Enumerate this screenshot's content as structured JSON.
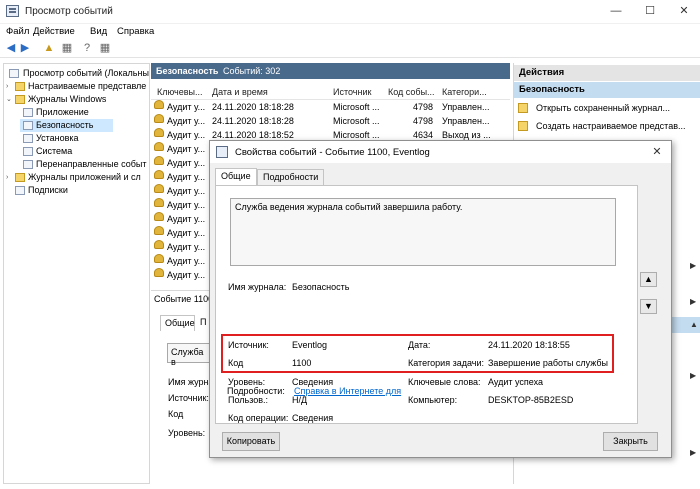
{
  "app": {
    "title": "Просмотр событий",
    "min": "—",
    "max": "☐",
    "close": "✕"
  },
  "menu": [
    "Файл",
    "Действие",
    "Вид",
    "Справка"
  ],
  "tree": {
    "root": "Просмотр событий (Локальны",
    "custom": "Настраиваемые представле",
    "winlogs": "Журналы Windows",
    "app": "Приложение",
    "security": "Безопасность",
    "setup": "Установка",
    "system": "Система",
    "forwarded": "Перенаправленные событ",
    "applogs": "Журналы приложений и сл",
    "subs": "Подписки"
  },
  "center": {
    "header_name": "Безопасность",
    "header_count": "Событий: 302",
    "columns": [
      "Ключевы...",
      "Дата и время",
      "Источник",
      "Код собы...",
      "Категори..."
    ],
    "rows": [
      {
        "kw": "Аудит у...",
        "date": "24.11.2020 18:18:28",
        "src": "Microsoft ...",
        "code": "4798",
        "cat": "Управлен..."
      },
      {
        "kw": "Аудит у...",
        "date": "24.11.2020 18:18:28",
        "src": "Microsoft ...",
        "code": "4798",
        "cat": "Управлен..."
      },
      {
        "kw": "Аудит у...",
        "date": "24.11.2020 18:18:52",
        "src": "Microsoft ...",
        "code": "4634",
        "cat": "Выход из ..."
      },
      {
        "kw": "Аудит у...",
        "date": "",
        "src": "",
        "code": "",
        "cat": ""
      },
      {
        "kw": "Аудит у...",
        "date": "",
        "src": "",
        "code": "",
        "cat": ""
      },
      {
        "kw": "Аудит у...",
        "date": "",
        "src": "",
        "code": "",
        "cat": ""
      },
      {
        "kw": "Аудит у...",
        "date": "",
        "src": "",
        "code": "",
        "cat": ""
      },
      {
        "kw": "Аудит у...",
        "date": "",
        "src": "",
        "code": "",
        "cat": ""
      },
      {
        "kw": "Аудит у...",
        "date": "",
        "src": "",
        "code": "",
        "cat": ""
      },
      {
        "kw": "Аудит у...",
        "date": "",
        "src": "",
        "code": "",
        "cat": ""
      },
      {
        "kw": "Аудит у...",
        "date": "",
        "src": "",
        "code": "",
        "cat": ""
      },
      {
        "kw": "Аудит у...",
        "date": "",
        "src": "",
        "code": "",
        "cat": ""
      },
      {
        "kw": "Аудит у...",
        "date": "",
        "src": "",
        "code": "",
        "cat": ""
      }
    ],
    "lower_title": "Событие 1100",
    "lower_tab1": "Общие",
    "lower_tab2": "П",
    "lower_text": "Служба в",
    "lower_f1": "Имя журна",
    "lower_f2": "Источник:",
    "lower_f3": "Код",
    "lower_f4": "Уровень:"
  },
  "actions": {
    "header": "Действия",
    "section": "Безопасность",
    "open_saved": "Открыть сохраненный журнал...",
    "create_view": "Создать настраиваемое представ..."
  },
  "dialog": {
    "title": "Свойства событий - Событие 1100, Eventlog",
    "close": "✕",
    "tab_general": "Общие",
    "tab_details": "Подробности",
    "message": "Служба ведения журнала событий завершила работу.",
    "log_name_label": "Имя журнала:",
    "log_name": "Безопасность",
    "source_label": "Источник:",
    "source": "Eventlog",
    "date_label": "Дата:",
    "date": "24.11.2020 18:18:55",
    "code_label": "Код",
    "code": "1100",
    "task_label": "Категория задачи:",
    "task": "Завершение работы службы",
    "level_label": "Уровень:",
    "level": "Сведения",
    "keywords_label": "Ключевые слова:",
    "keywords": "Аудит успеха",
    "user_label": "Пользов.:",
    "user": "Н/Д",
    "computer_label": "Компьютер:",
    "computer": "DESKTOP-85B2ESD",
    "opcode_label": "Код операции:",
    "opcode": "Сведения",
    "more_label": "Подробности:",
    "more_link": "Справка в Интернете для",
    "copy_btn": "Копировать",
    "close_btn": "Закрыть"
  }
}
